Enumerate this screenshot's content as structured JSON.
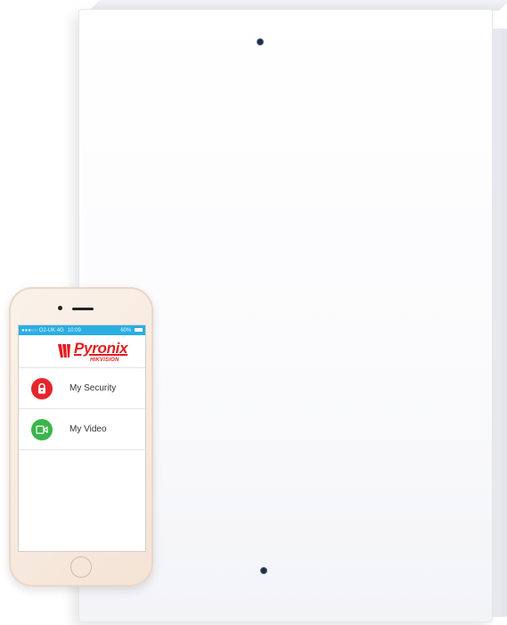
{
  "status_bar": {
    "carrier": "●●●○○ O2-UK  4G",
    "time": "10:09",
    "battery": "60%"
  },
  "app": {
    "brand": "Pyronix",
    "sub_brand": "HIKVISION",
    "brand_color": "#e11d24",
    "status_color": "#29aee3"
  },
  "menu": {
    "items": [
      {
        "label": "My Security",
        "icon": "padlock-icon",
        "color": "#e4262c"
      },
      {
        "label": "My Video",
        "icon": "video-camera-icon",
        "color": "#3bb54a"
      }
    ]
  }
}
